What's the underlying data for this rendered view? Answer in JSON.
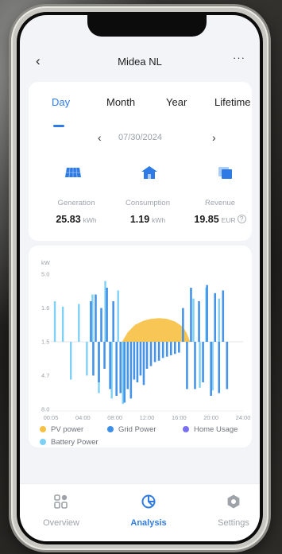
{
  "header": {
    "title": "Midea NL",
    "back_icon": "chevron-left-icon",
    "more_label": "···"
  },
  "tabs": [
    {
      "label": "Day",
      "active": true
    },
    {
      "label": "Month",
      "active": false
    },
    {
      "label": "Year",
      "active": false
    },
    {
      "label": "Lifetime",
      "active": false
    }
  ],
  "date_selector": {
    "date": "07/30/2024",
    "prev_label": "‹",
    "next_label": "›"
  },
  "stats": [
    {
      "label": "Generation",
      "value": "25.83",
      "unit": "kWh",
      "icon": "solar-panel-icon"
    },
    {
      "label": "Consumption",
      "value": "1.19",
      "unit": "kWh",
      "icon": "house-icon"
    },
    {
      "label": "Revenue",
      "value": "19.85",
      "unit": "EUR",
      "icon": "revenue-icon",
      "info_label": "?"
    }
  ],
  "chart_data": {
    "type": "area",
    "ylabel": "kW",
    "y_tick_labels": [
      "5.0",
      "1.6",
      "1.5",
      "4.7",
      "8.0"
    ],
    "x_tick_labels": [
      "00:05",
      "04:00",
      "08:00",
      "12:00",
      "16:00",
      "20:00",
      "24:00"
    ],
    "series": [
      {
        "name": "PV power",
        "color": "#f6c145",
        "x": [
          8.9,
          9.6,
          10.5,
          11.5,
          12.5,
          13.5,
          14.5,
          15.5,
          16.5,
          17.0,
          17.4
        ],
        "y": [
          0,
          0.7,
          1.25,
          1.55,
          1.7,
          1.75,
          1.7,
          1.5,
          1.1,
          0.6,
          0
        ]
      },
      {
        "name": "Grid Power",
        "color": "#3d8ee6",
        "x": [
          5.0,
          5.3,
          5.6,
          6.0,
          6.3,
          6.7,
          7.0,
          7.4,
          7.8,
          8.2,
          8.7,
          9.2,
          9.6,
          10.0,
          10.4,
          10.8,
          11.2,
          11.6,
          12.0,
          12.5,
          13.0,
          13.5,
          14.0,
          14.5,
          15.0,
          15.5,
          16.0,
          16.5,
          17.0,
          17.5,
          18.0,
          18.5,
          19.0,
          19.5,
          20.0,
          20.5,
          21.0,
          21.5,
          22.0
        ],
        "y": [
          3.0,
          -2.5,
          3.5,
          -3.0,
          2.5,
          -2.0,
          4.0,
          -3.5,
          3.0,
          -4.0,
          -3.8,
          -4.5,
          -3.5,
          -4.2,
          -2.8,
          -3.0,
          -2.5,
          -3.2,
          -2.0,
          -1.8,
          -1.5,
          -1.4,
          -1.2,
          -1.1,
          -1.0,
          -0.9,
          -0.8,
          2.5,
          -3.5,
          4.0,
          -3.5,
          3.0,
          -3.0,
          4.2,
          -4.0,
          3.6,
          -3.8,
          3.8,
          -3.5
        ]
      },
      {
        "name": "Home Usage",
        "color": "#7a6ff0",
        "x": [],
        "y": []
      },
      {
        "name": "Battery Power",
        "color": "#7fd0f5",
        "x": [
          0.5,
          1.5,
          2.5,
          3.5,
          4.5,
          5.2,
          6.0,
          6.8,
          7.6,
          8.4,
          9.0,
          17.8,
          18.6,
          19.4,
          20.2,
          21.0
        ],
        "y": [
          3.0,
          2.6,
          -2.8,
          2.8,
          -2.5,
          3.5,
          -3.8,
          4.5,
          -4.2,
          3.8,
          -4.6,
          3.2,
          -3.4,
          4.0,
          -3.6,
          3.2
        ]
      }
    ]
  },
  "tabbar": [
    {
      "label": "Overview",
      "icon": "overview-icon",
      "active": false
    },
    {
      "label": "Analysis",
      "icon": "analysis-icon",
      "active": true
    },
    {
      "label": "Settings",
      "icon": "gear-icon",
      "active": false
    }
  ]
}
